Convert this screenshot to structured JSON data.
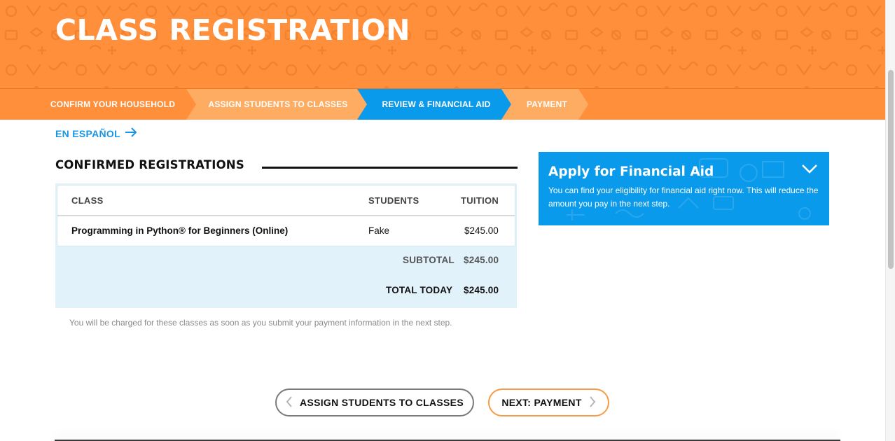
{
  "header": {
    "title": "CLASS REGISTRATION"
  },
  "steps": [
    {
      "label": "CONFIRM YOUR HOUSEHOLD",
      "state": "done"
    },
    {
      "label": "ASSIGN STUDENTS TO CLASSES",
      "state": "done"
    },
    {
      "label": "REVIEW & FINANCIAL AID",
      "state": "active"
    },
    {
      "label": "PAYMENT",
      "state": "upcoming"
    }
  ],
  "colors": {
    "orange": "#ff8f3a",
    "orange_light": "#ffac63",
    "blue": "#0a9aeb",
    "panel_blue": "#e1f2fb"
  },
  "language_link": {
    "label": "EN ESPAÑOL",
    "icon": "arrow-right-icon"
  },
  "registrations": {
    "title": "CONFIRMED REGISTRATIONS",
    "columns": {
      "class": "CLASS",
      "students": "STUDENTS",
      "tuition": "TUITION"
    },
    "rows": [
      {
        "class": "Programming in Python® for Beginners (Online)",
        "students": "Fake",
        "tuition": "$245.00"
      }
    ],
    "subtotal": {
      "label": "SUBTOTAL",
      "value": "$245.00"
    },
    "total": {
      "label": "TOTAL TODAY",
      "value": "$245.00"
    },
    "note": "You will be charged for these classes as soon as you submit your payment information in the next step."
  },
  "financial_aid": {
    "title": "Apply for Financial Aid",
    "body": "You can find your eligibility for financial aid right now. This will reduce the amount you pay in the next step.",
    "icon": "chevron-down-icon"
  },
  "buttons": {
    "back": {
      "label": "ASSIGN STUDENTS TO CLASSES",
      "icon": "chevron-left-icon"
    },
    "next": {
      "label": "NEXT: PAYMENT",
      "icon": "chevron-right-icon"
    }
  }
}
